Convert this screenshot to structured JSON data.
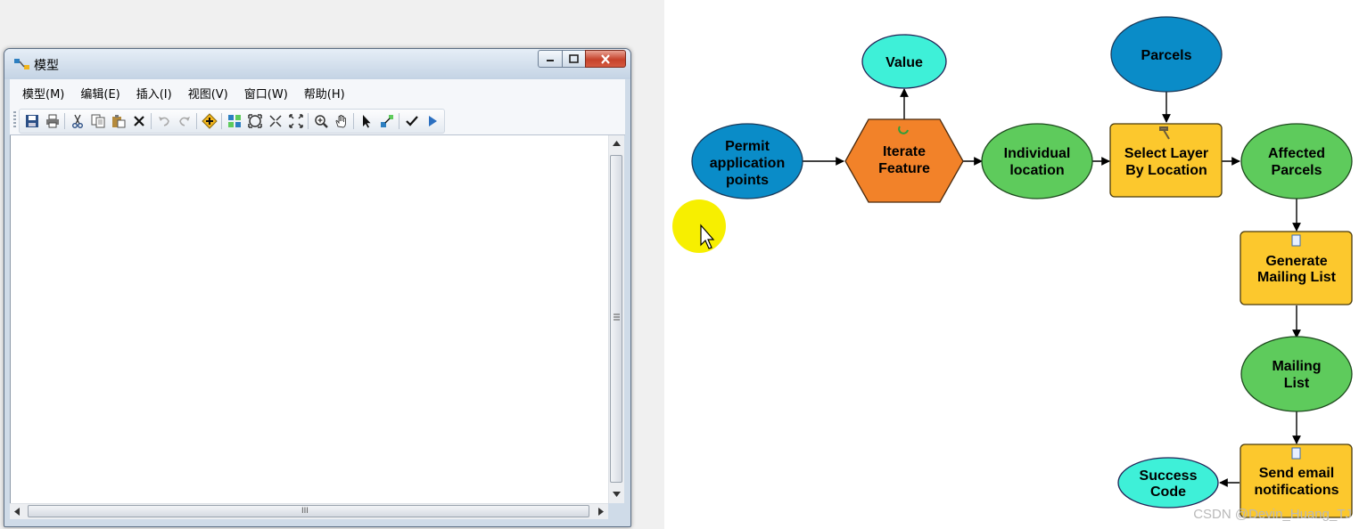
{
  "window": {
    "title": "模型",
    "menu": [
      "模型(M)",
      "编辑(E)",
      "插入(I)",
      "视图(V)",
      "窗口(W)",
      "帮助(H)"
    ],
    "toolbar_icons": [
      "save-icon",
      "print-icon",
      "cut-icon",
      "copy-icon",
      "paste-icon",
      "delete-icon",
      "undo-icon",
      "redo-icon",
      "add-data-icon",
      "auto-layout-icon",
      "full-extent-icon",
      "zoom-in-fixed-icon",
      "zoom-out-fixed-icon",
      "zoom-in-icon",
      "pan-icon",
      "select-icon",
      "connect-icon",
      "validate-icon",
      "run-icon"
    ],
    "hscroll_grip": "III"
  },
  "model": {
    "nodes": [
      {
        "id": "permit",
        "label": [
          "Permit",
          "application",
          "points"
        ],
        "kind": "input-data",
        "color": "#0a8cc8"
      },
      {
        "id": "iterate",
        "label": [
          "Iterate",
          "Feature"
        ],
        "kind": "iterator",
        "color": "#f28229"
      },
      {
        "id": "value",
        "label": [
          "Value"
        ],
        "kind": "derived-value",
        "color": "#3ef0d8"
      },
      {
        "id": "individual",
        "label": [
          "Individual",
          "location"
        ],
        "kind": "derived-data",
        "color": "#5ecb5c"
      },
      {
        "id": "parcels",
        "label": [
          "Parcels"
        ],
        "kind": "input-data",
        "color": "#0a8cc8"
      },
      {
        "id": "select",
        "label": [
          "Select Layer",
          "By Location"
        ],
        "kind": "tool",
        "color": "#fcc82d"
      },
      {
        "id": "affected",
        "label": [
          "Affected",
          "Parcels"
        ],
        "kind": "derived-data",
        "color": "#5ecb5c"
      },
      {
        "id": "generate",
        "label": [
          "Generate",
          "Mailing List"
        ],
        "kind": "script-tool",
        "color": "#fcc82d"
      },
      {
        "id": "mailing",
        "label": [
          "Mailing",
          "List"
        ],
        "kind": "derived-data",
        "color": "#5ecb5c"
      },
      {
        "id": "send",
        "label": [
          "Send email",
          "notifications"
        ],
        "kind": "script-tool",
        "color": "#fcc82d"
      },
      {
        "id": "success",
        "label": [
          "Success",
          "Code"
        ],
        "kind": "derived-value",
        "color": "#3ef0d8"
      }
    ],
    "edges": [
      [
        "permit",
        "iterate"
      ],
      [
        "iterate",
        "value"
      ],
      [
        "iterate",
        "individual"
      ],
      [
        "individual",
        "select"
      ],
      [
        "parcels",
        "select"
      ],
      [
        "select",
        "affected"
      ],
      [
        "affected",
        "generate"
      ],
      [
        "generate",
        "mailing"
      ],
      [
        "mailing",
        "send"
      ],
      [
        "send",
        "success"
      ]
    ]
  },
  "watermark": "CSDN @Devin_Huang_TJ"
}
